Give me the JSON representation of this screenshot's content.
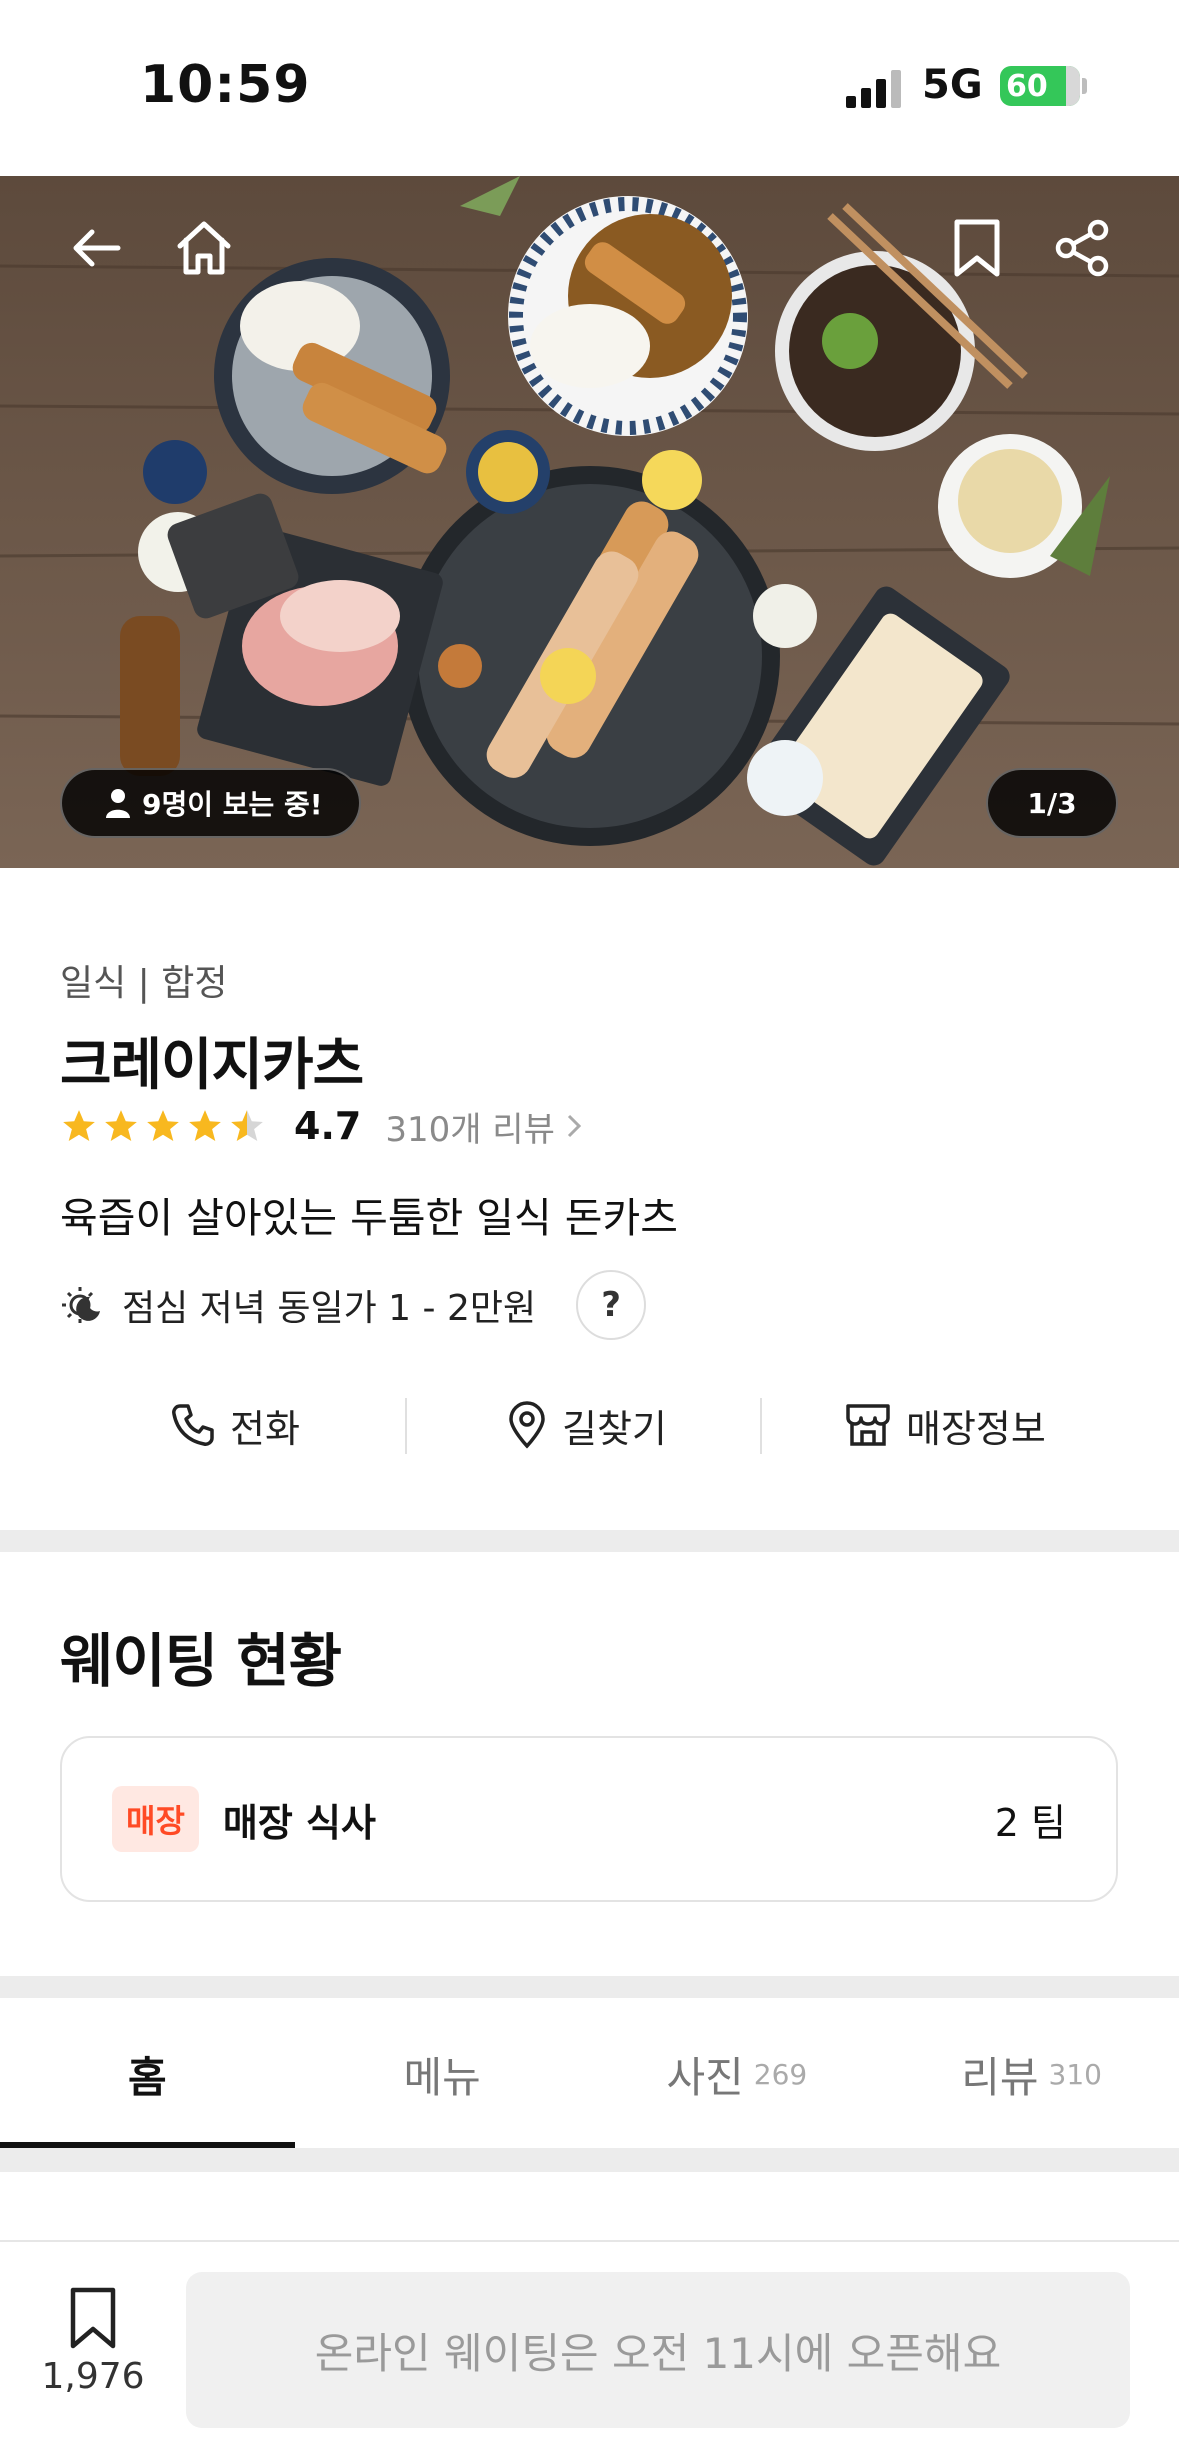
{
  "status_bar": {
    "time": "10:59",
    "network": "5G",
    "battery": "60"
  },
  "hero": {
    "viewers_text": "9명이 보는 중!",
    "page_indicator": "1/3",
    "icons": [
      "back-arrow-icon",
      "home-icon",
      "bookmark-icon",
      "share-icon"
    ]
  },
  "store": {
    "category": "일식 | 합정",
    "name": "크레이지카츠",
    "rating": "4.7",
    "stars": 4.5,
    "review_link": "310개 리뷰",
    "description": "육즙이 살아있는 두툼한 일식 돈카츠",
    "price_info": "점심 저녁 동일가 1 - 2만원",
    "help_label": "?"
  },
  "actions": [
    {
      "label": "전화",
      "icon": "phone-icon"
    },
    {
      "label": "길찾기",
      "icon": "map-pin-icon"
    },
    {
      "label": "매장정보",
      "icon": "store-icon"
    }
  ],
  "waiting": {
    "title": "웨이팅 현황",
    "badge": "매장",
    "label": "매장 식사",
    "count": "2 팀"
  },
  "tabs": [
    {
      "label": "홈",
      "count": ""
    },
    {
      "label": "메뉴",
      "count": ""
    },
    {
      "label": "사진",
      "count": "269"
    },
    {
      "label": "리뷰",
      "count": "310"
    }
  ],
  "bottom_bar": {
    "save_count": "1,976",
    "cta_label": "온라인 웨이팅은 오전 11시에 오픈해요"
  },
  "colors": {
    "accent": "#ff4a25",
    "star": "#f8b81f",
    "battery": "#34c759"
  }
}
